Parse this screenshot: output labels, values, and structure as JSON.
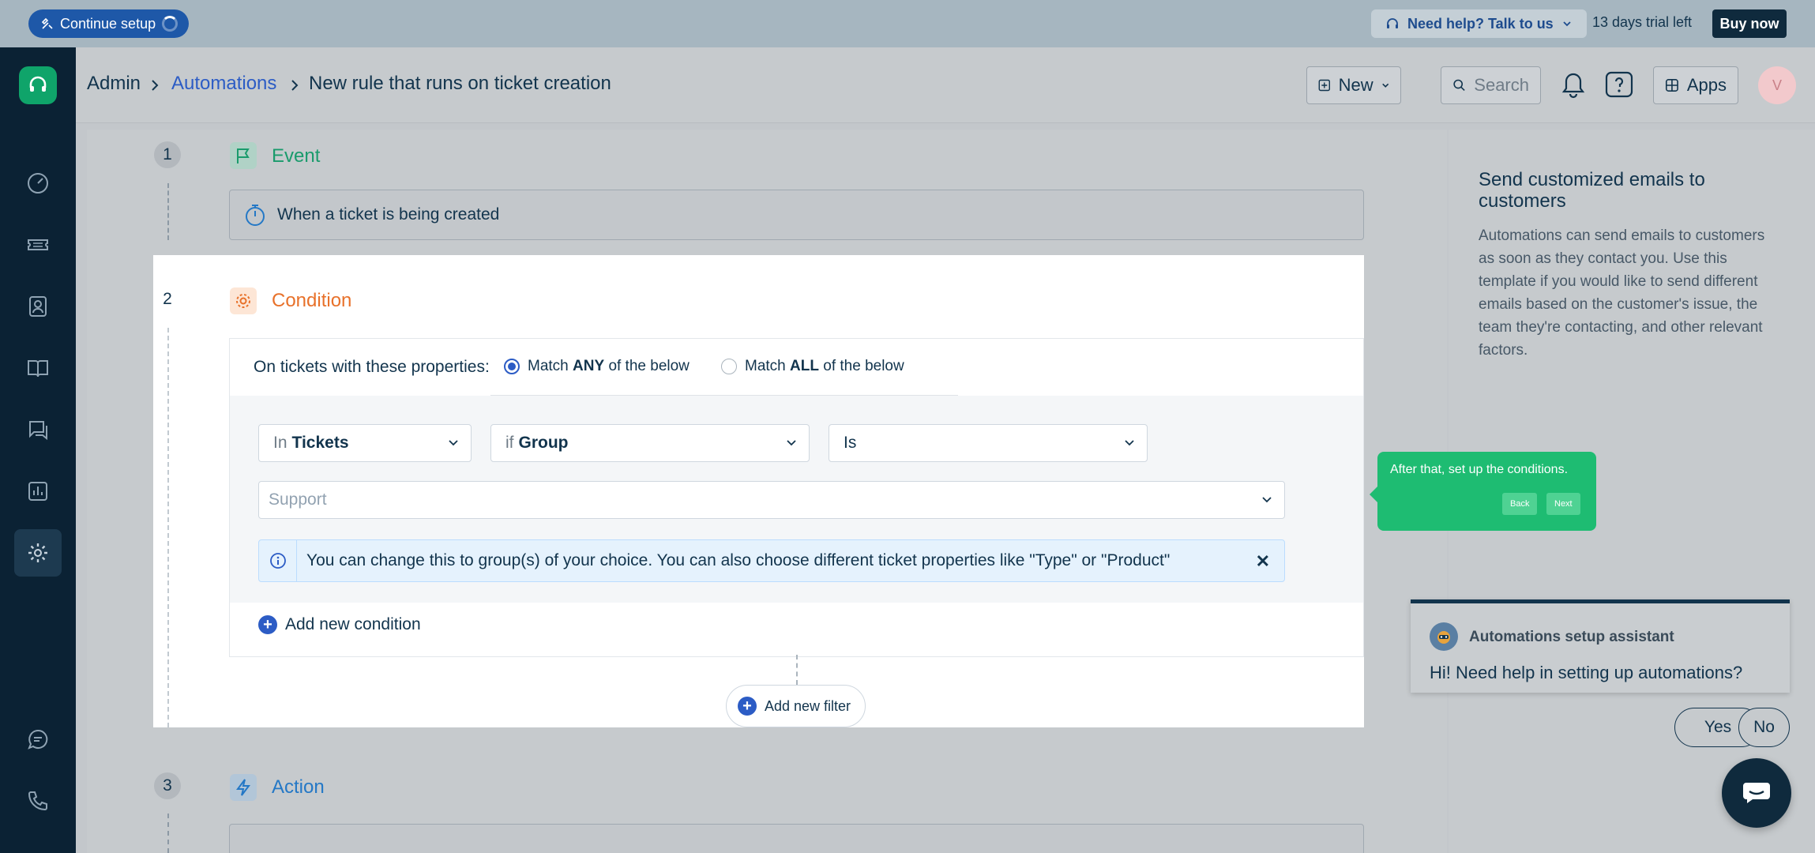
{
  "banner": {
    "continue_label": "Continue setup",
    "help_label": "Need help? Talk to us",
    "trial_text": "13 days trial left",
    "buy_label": "Buy now"
  },
  "breadcrumb": {
    "root": "Admin",
    "parent": "Automations",
    "current": "New rule that runs on ticket creation"
  },
  "header": {
    "new_label": "New",
    "search_placeholder": "Search",
    "apps_label": "Apps",
    "avatar_initial": "V"
  },
  "steps": {
    "event": {
      "number": "1",
      "title": "Event",
      "value": "When a ticket is being created"
    },
    "condition": {
      "number": "2",
      "title": "Condition",
      "props_label": "On tickets with these properties:",
      "match_any_prefix": "Match",
      "match_any_bold": "ANY",
      "match_any_suffix": "of the below",
      "match_all_prefix": "Match",
      "match_all_bold": "ALL",
      "match_all_suffix": "of the below",
      "selected_match": "ANY",
      "in_prefix": "In",
      "in_value": "Tickets",
      "if_prefix": "if",
      "if_value": "Group",
      "operator": "Is",
      "value_placeholder": "Support",
      "info_text": "You can change this to group(s) of your choice. You can also choose different ticket properties like \"Type\" or \"Product\"",
      "add_condition": "Add new condition",
      "add_filter": "Add new filter"
    },
    "action": {
      "number": "3",
      "title": "Action"
    }
  },
  "right_panel": {
    "title": "Send customized emails to customers",
    "body": "Automations can send emails to customers as soon as they contact you. Use this template if you would like to send different emails based on the customer's issue, the team they're contacting, and other relevant factors."
  },
  "tooltip": {
    "text": "After that, set up the conditions.",
    "back": "Back",
    "next": "Next"
  },
  "assistant": {
    "name": "Automations setup assistant",
    "message": "Hi! Need help in setting up automations?",
    "yes": "Yes",
    "no": "No"
  },
  "colors": {
    "sidebar": "#0b2234",
    "brand_green": "#0fa46a",
    "link_blue": "#2c5cc5",
    "event_green": "#1a9b6c",
    "condition_orange": "#e8712a",
    "action_blue": "#2478c6",
    "tooltip_green": "#1ebc72"
  },
  "sidebar_icons": [
    "headset-logo-icon",
    "dashboard-icon",
    "tickets-icon",
    "contacts-icon",
    "knowledge-base-icon",
    "forums-icon",
    "analytics-icon",
    "admin-gear-icon",
    "chat-icon",
    "phone-icon",
    "apps-grid-icon"
  ]
}
